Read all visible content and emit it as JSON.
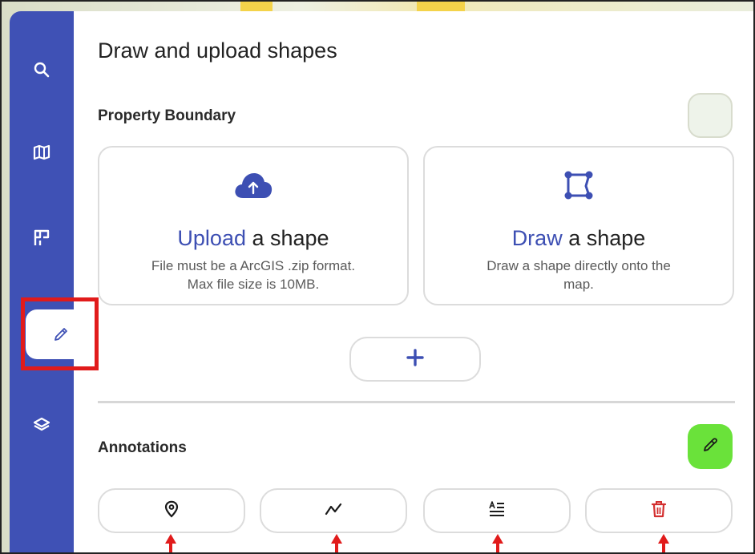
{
  "colors": {
    "sidebar": "#3f51b5",
    "accent": "#3d4fb3",
    "annotation_toggle": "#6ae23a",
    "delete": "#d32f2f",
    "highlight": "#e11b1b"
  },
  "sidebar": {
    "items": [
      {
        "name": "search",
        "icon": "search-icon"
      },
      {
        "name": "map",
        "icon": "map-icon"
      },
      {
        "name": "plan",
        "icon": "floorplan-icon"
      },
      {
        "name": "draw",
        "icon": "pencil-icon",
        "active": true
      },
      {
        "name": "layers",
        "icon": "layers-icon"
      }
    ]
  },
  "panel": {
    "title": "Draw and upload shapes",
    "property_boundary": {
      "title": "Property Boundary",
      "upload_card": {
        "accent": "Upload",
        "rest": " a shape",
        "desc_line1": "File must be a ArcGIS .zip format.",
        "desc_line2": "Max file size is 10MB.",
        "icon": "cloud-upload-icon"
      },
      "draw_card": {
        "accent": "Draw",
        "rest": " a shape",
        "desc_line1": "Draw a shape directly onto the",
        "desc_line2": "map.",
        "icon": "polygon-draw-icon"
      },
      "add_button_icon": "plus-icon"
    },
    "annotations": {
      "title": "Annotations",
      "toggle_icon": "eyedropper-icon",
      "tools": [
        {
          "name": "marker",
          "icon": "location-pin-icon"
        },
        {
          "name": "line",
          "icon": "line-icon"
        },
        {
          "name": "text",
          "icon": "text-icon"
        },
        {
          "name": "delete",
          "icon": "trash-icon"
        }
      ]
    }
  }
}
